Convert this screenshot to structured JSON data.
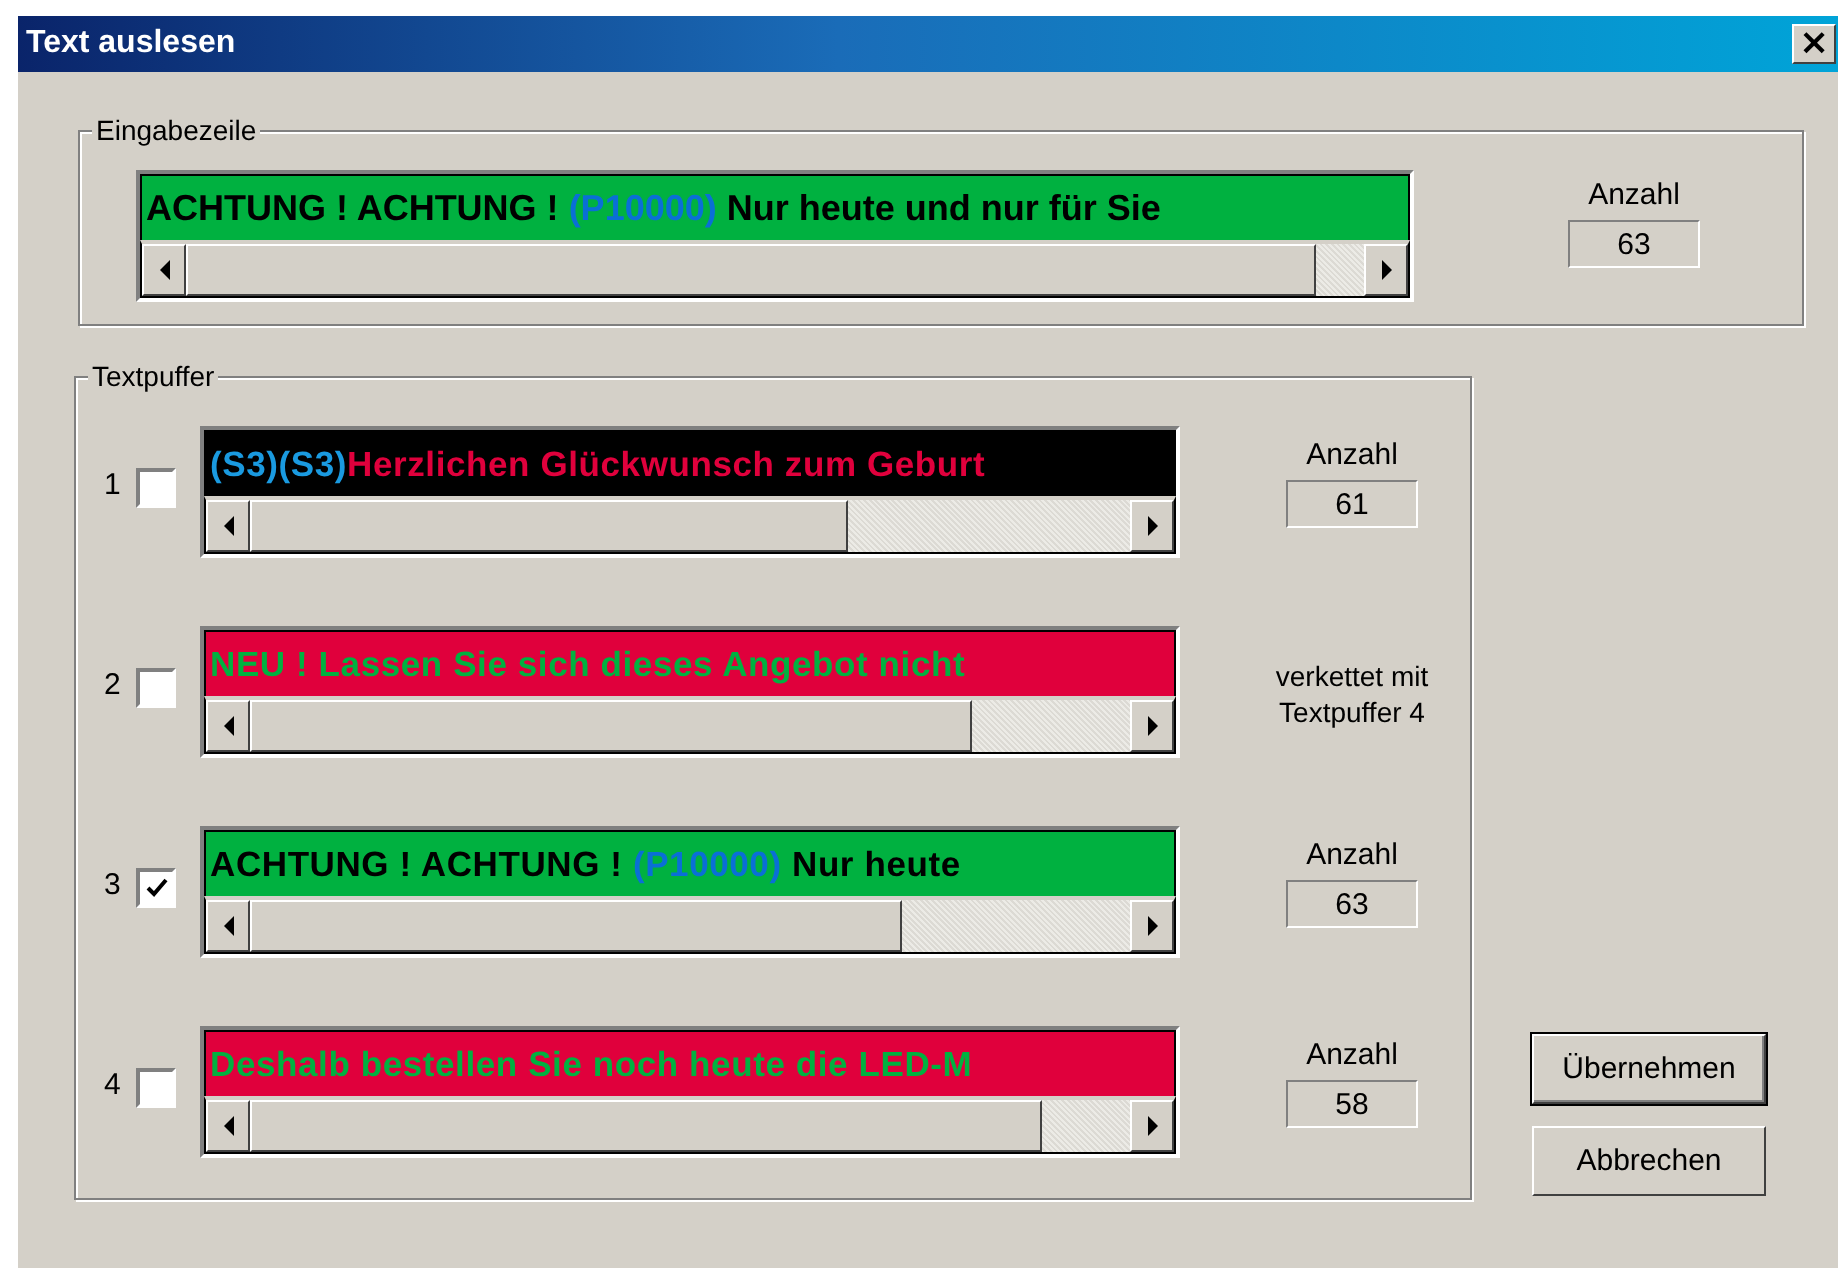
{
  "window": {
    "title": "Text auslesen",
    "close": "×"
  },
  "input_group": {
    "title": "Eingabezeile",
    "display": {
      "color": "#00b140",
      "segments": [
        {
          "text": "ACHTUNG ! ACHTUNG ! ",
          "color": "#000000"
        },
        {
          "text": "(P10000)",
          "color": "#0a6fd6"
        },
        {
          "text": " Nur heute und nur für Sie",
          "color": "#000000"
        }
      ]
    },
    "count_label": "Anzahl",
    "count": "63"
  },
  "buffer_group": {
    "title": "Textpuffer",
    "buffers": [
      {
        "number": "1",
        "checked": false,
        "color": "#000000",
        "segments": [
          {
            "text": "(S3)(S3)",
            "color": "#1a9ae0"
          },
          {
            "text": "Herzlichen Glückwunsch zum Geburt",
            "color": "#e0003c"
          }
        ],
        "kind": "count",
        "count_label": "Anzahl",
        "count": "61"
      },
      {
        "number": "2",
        "checked": false,
        "color": "#e0003c",
        "segments": [
          {
            "text": "NEU ! Lassen Sie sich dieses Angebot nicht",
            "color": "#00b140"
          }
        ],
        "kind": "note",
        "note": "verkettet mit Textpuffer 4"
      },
      {
        "number": "3",
        "checked": true,
        "color": "#00b140",
        "segments": [
          {
            "text": "ACHTUNG ! ACHTUNG ! ",
            "color": "#000000"
          },
          {
            "text": "(P10000)",
            "color": "#0a6fd6"
          },
          {
            "text": " Nur heute",
            "color": "#000000"
          }
        ],
        "kind": "count",
        "count_label": "Anzahl",
        "count": "63"
      },
      {
        "number": "4",
        "checked": false,
        "color": "#e0003c",
        "segments": [
          {
            "text": "Deshalb bestellen Sie noch heute die LED-M",
            "color": "#00b140"
          }
        ],
        "kind": "count",
        "count_label": "Anzahl",
        "count": "58"
      }
    ]
  },
  "buttons": [
    "Übernehmen",
    "Abbrechen"
  ]
}
